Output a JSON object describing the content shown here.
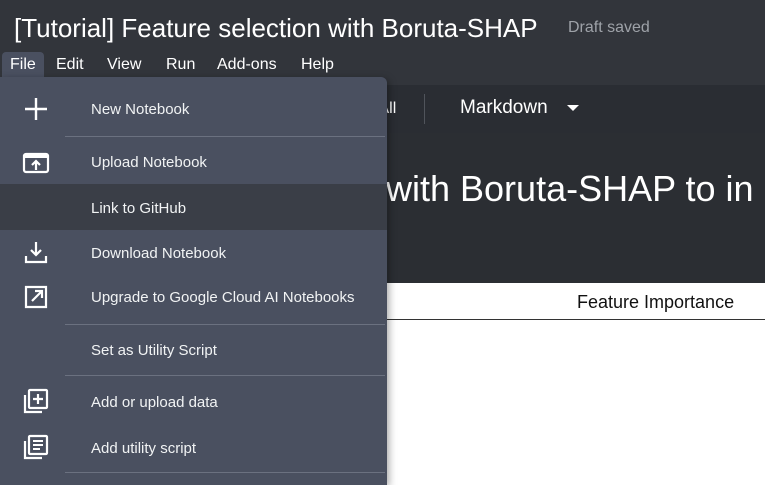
{
  "header": {
    "title": "[Tutorial] Feature selection with Boruta-SHAP",
    "status": "Draft saved"
  },
  "menubar": {
    "items": [
      "File",
      "Edit",
      "View",
      "Run",
      "Add-ons",
      "Help"
    ],
    "active": "File"
  },
  "toolbar": {
    "run_all_partial": "n All",
    "cell_type": "Markdown"
  },
  "notebook": {
    "markdown_heading_partial": "with Boruta-SHAP to in",
    "table_header": "Feature Importance"
  },
  "file_menu": {
    "items": [
      {
        "label": "New Notebook",
        "icon": "plus-icon"
      },
      {
        "label": "Upload Notebook",
        "icon": "upload-icon"
      },
      {
        "label": "Link to GitHub",
        "icon": "",
        "highlighted": true
      },
      {
        "label": "Download Notebook",
        "icon": "download-icon"
      },
      {
        "label": "Upgrade to Google Cloud AI Notebooks",
        "icon": "open-external-icon"
      },
      {
        "label": "Set as Utility Script",
        "icon": ""
      },
      {
        "label": "Add or upload data",
        "icon": "add-data-icon"
      },
      {
        "label": "Add utility script",
        "icon": "utility-script-icon"
      }
    ]
  },
  "colors": {
    "header_bg": "#32353b",
    "menu_bg": "#4a5060",
    "menu_highlight": "#3a3e47",
    "text": "#ffffff"
  }
}
